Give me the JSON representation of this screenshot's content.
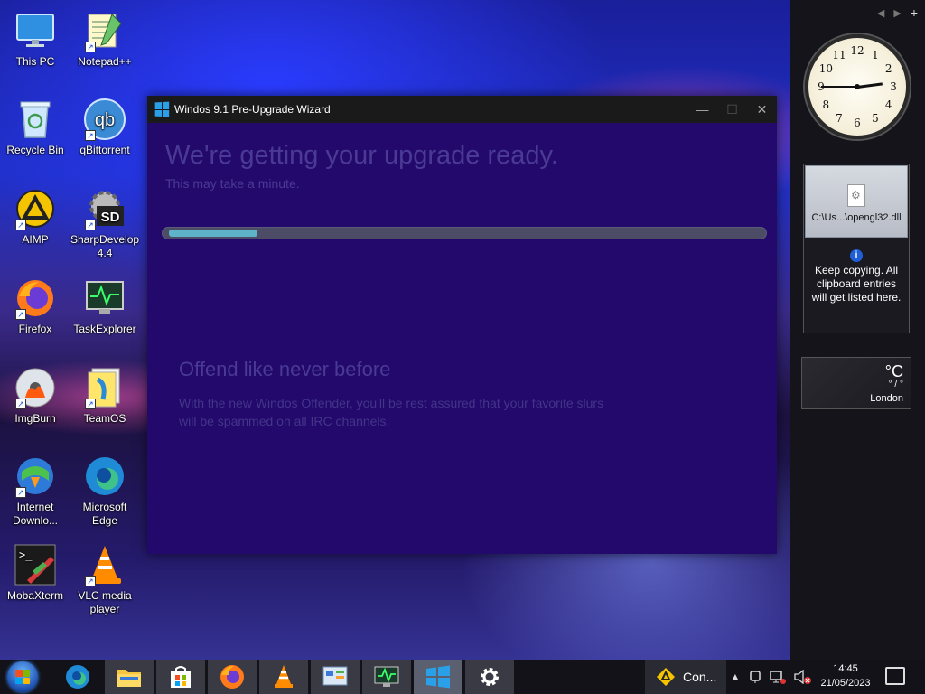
{
  "desktop": {
    "icons": [
      {
        "label": "This PC",
        "icon": "computer-icon"
      },
      {
        "label": "Notepad++",
        "icon": "notepadpp-icon"
      },
      {
        "label": "Recycle Bin",
        "icon": "recycle-bin-icon"
      },
      {
        "label": "qBittorrent",
        "icon": "qbittorrent-icon"
      },
      {
        "label": "AIMP",
        "icon": "aimp-icon"
      },
      {
        "label": "SharpDevelop 4.4",
        "icon": "sharpdevelop-icon"
      },
      {
        "label": "Firefox",
        "icon": "firefox-icon"
      },
      {
        "label": "TaskExplorer",
        "icon": "taskexplorer-icon"
      },
      {
        "label": "ImgBurn",
        "icon": "imgburn-icon"
      },
      {
        "label": "TeamOS",
        "icon": "teamos-icon"
      },
      {
        "label": "Internet Downlo...",
        "icon": "idm-icon"
      },
      {
        "label": "Microsoft Edge",
        "icon": "edge-icon"
      },
      {
        "label": "MobaXterm",
        "icon": "mobaxterm-icon"
      },
      {
        "label": "VLC media player",
        "icon": "vlc-icon"
      }
    ]
  },
  "wizard": {
    "title": "Windos 9.1 Pre-Upgrade Wizard",
    "heading": "We're getting your upgrade ready.",
    "subheading": "This may take a minute.",
    "progress": 0.15,
    "feature_title": "Offend like never before",
    "feature_body": "With the new Windos Offender, you'll be rest assured that your favorite slurs will be spammed on all IRC channels.",
    "controls": {
      "minimize": "—",
      "maximize": "☐",
      "close": "✕"
    }
  },
  "sidebar": {
    "nav": {
      "prev": "◀",
      "next": "▶",
      "add": "+"
    },
    "clock": {
      "numbers": [
        "12",
        "1",
        "2",
        "3",
        "4",
        "5",
        "6",
        "7",
        "8",
        "9",
        "10",
        "11"
      ],
      "hours": 14,
      "minutes": 45
    },
    "clipboard": {
      "item": "C:\\Us...\\opengl32.dll",
      "info": "Keep copying. All clipboard entries will get listed here.",
      "info_icon": "i"
    },
    "weather": {
      "unit": "°C",
      "condition": "° / °",
      "city": "London"
    }
  },
  "taskbar": {
    "pinned": [
      {
        "name": "taskbar-edge",
        "icon": "edge-icon"
      },
      {
        "name": "taskbar-file-explorer",
        "icon": "folder-icon"
      },
      {
        "name": "taskbar-store",
        "icon": "store-icon"
      },
      {
        "name": "taskbar-firefox",
        "icon": "firefox-icon"
      },
      {
        "name": "taskbar-vlc",
        "icon": "vlc-icon"
      },
      {
        "name": "taskbar-control-panel",
        "icon": "control-panel-icon"
      },
      {
        "name": "taskbar-taskexplorer",
        "icon": "taskexplorer-icon"
      },
      {
        "name": "taskbar-wizard",
        "icon": "windows-logo-icon"
      },
      {
        "name": "taskbar-settings",
        "icon": "gear-icon"
      }
    ],
    "task_label": "Con...",
    "time": "14:45",
    "date": "21/05/2023"
  },
  "colors": {
    "wizard_bg": "#22096b",
    "progress_fill": "#5fb3c8",
    "progress_track": "#4c4c66",
    "faded_text": "#4a3a95"
  }
}
